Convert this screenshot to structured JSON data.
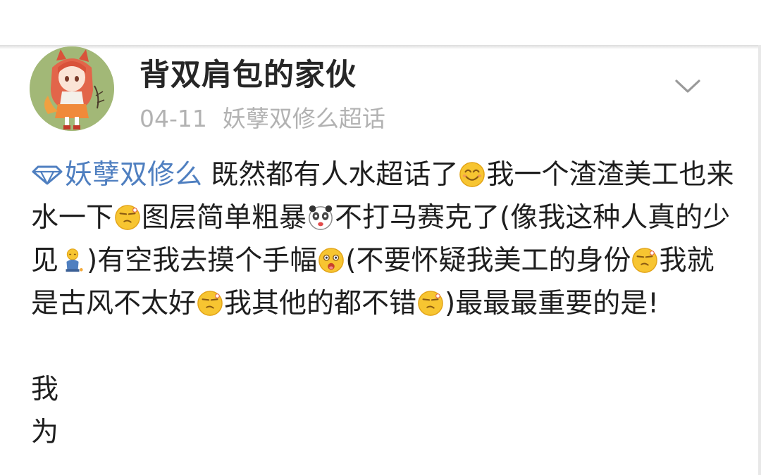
{
  "post": {
    "username": "背双肩包的家伙",
    "date": "04-11",
    "source": "妖孽双修么超话",
    "topic_link": "妖孽双修么",
    "text_1": "既然都有人水超话了",
    "text_2": "我一个渣渣美工也来水一下",
    "text_3": "图层简单粗暴",
    "text_4": "不打马赛克了(像我这种人真的少见",
    "text_5": ")有空我去摸个手幅",
    "text_6": "(不要怀疑我美工的身份",
    "text_7": "我就是古风不太好",
    "text_8": "我其他的都不错",
    "text_9": ")最最最重要的是!",
    "line_a": "我",
    "line_b": "为"
  },
  "icons": {
    "avatar": "anime-girl-avatar",
    "chevron": "chevron-down-icon",
    "topic": "diamond-topic-icon",
    "emojis": [
      "smile-emoji",
      "dizzy-emoji",
      "panda-emoji",
      "squat-emoji",
      "shocked-emoji",
      "dizzy-emoji",
      "dizzy-emoji",
      "dizzy-emoji"
    ]
  },
  "colors": {
    "link": "#4f7fc0",
    "text": "#1e1e1e",
    "meta": "#b2b2b2",
    "avatar_bg": "#a2b877"
  }
}
